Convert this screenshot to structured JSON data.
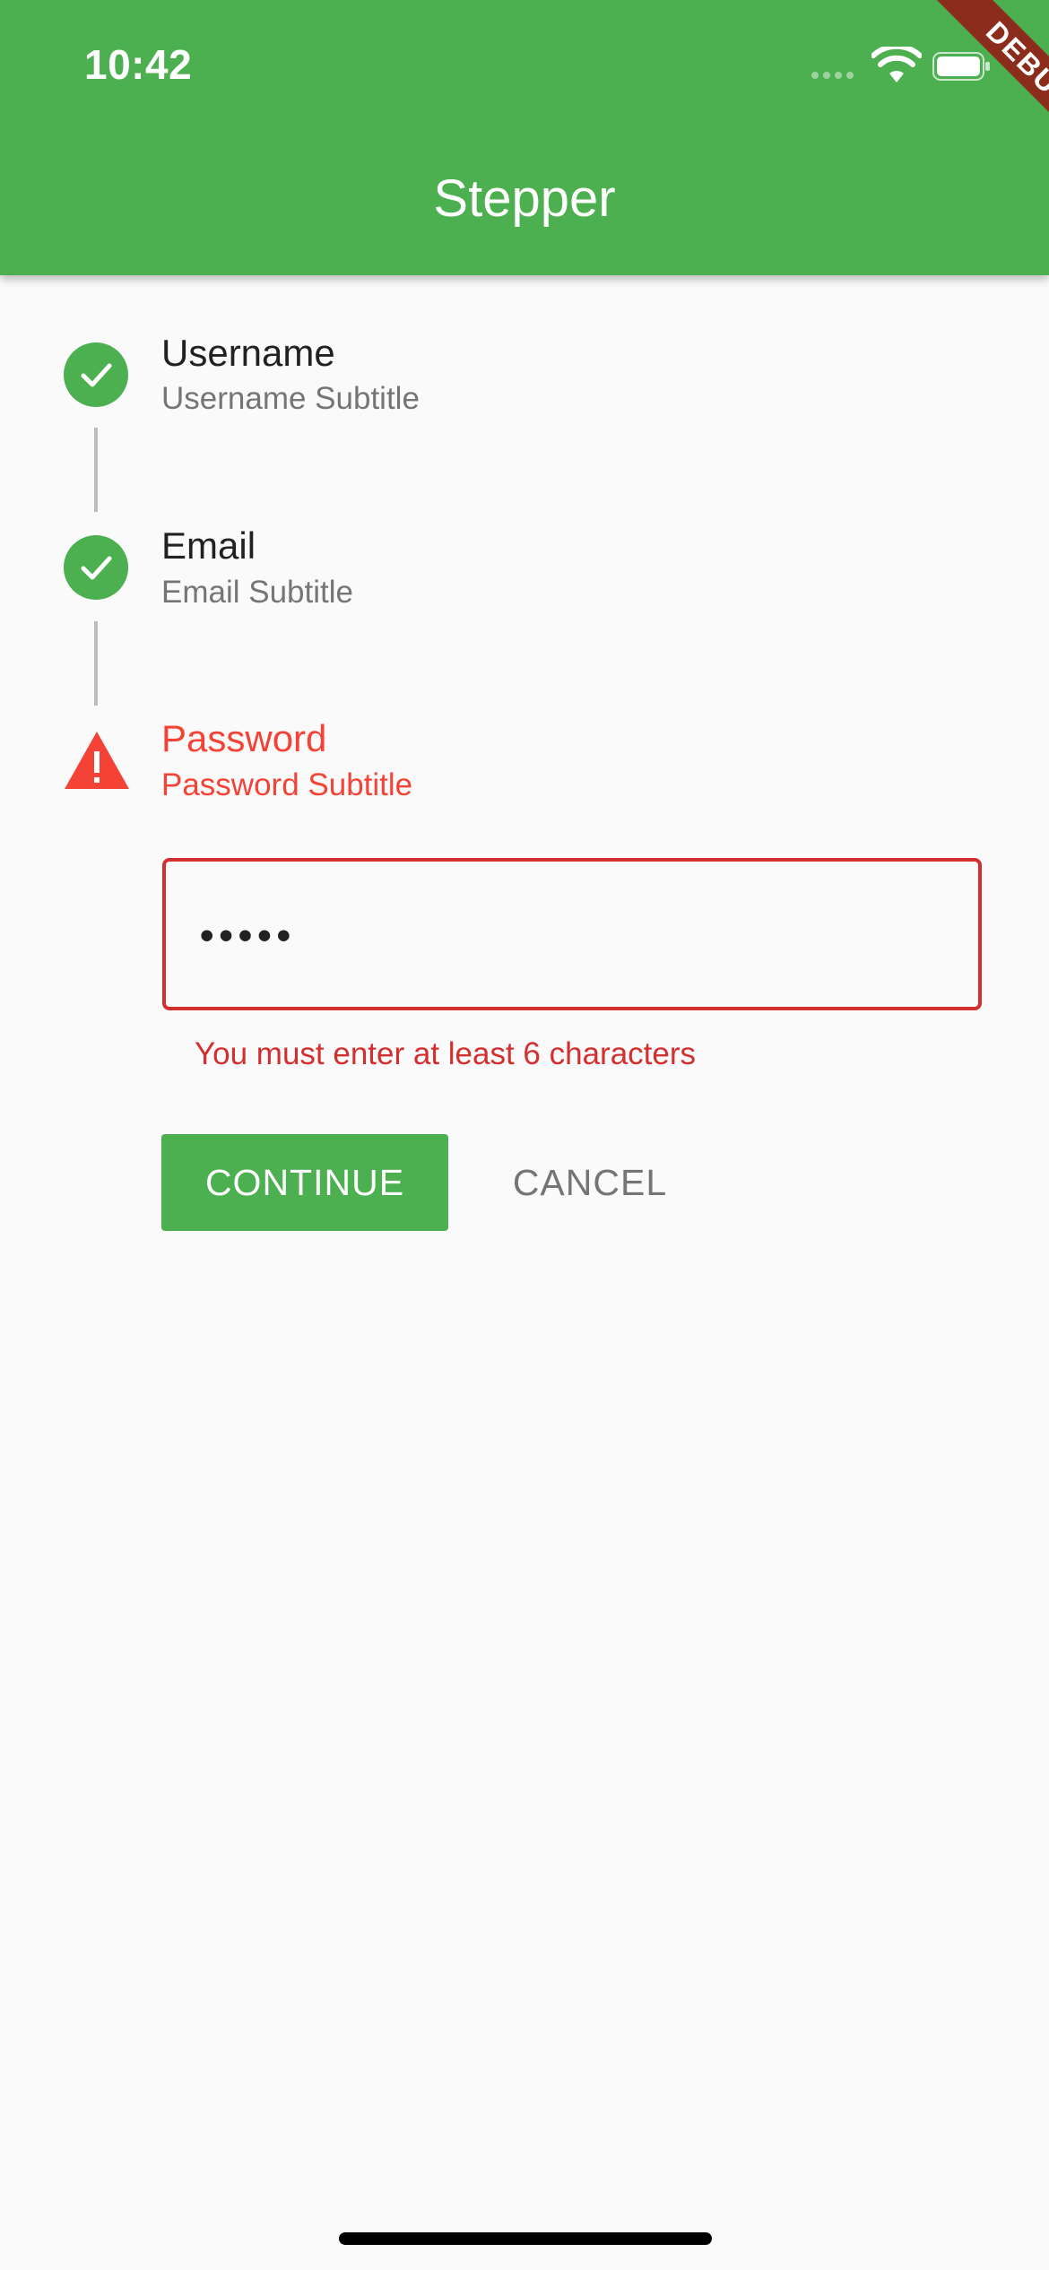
{
  "status_bar": {
    "time": "10:42",
    "icons": [
      "signal-dots-icon",
      "wifi-icon",
      "battery-icon"
    ]
  },
  "debug_banner": {
    "label": "DEBUG"
  },
  "app_bar": {
    "title": "Stepper"
  },
  "stepper": {
    "steps": [
      {
        "title": "Username",
        "subtitle": "Username Subtitle",
        "state": "complete",
        "icon": "check-icon"
      },
      {
        "title": "Email",
        "subtitle": "Email Subtitle",
        "state": "complete",
        "icon": "check-icon"
      },
      {
        "title": "Password",
        "subtitle": "Password Subtitle",
        "state": "error",
        "icon": "warning-icon"
      }
    ],
    "password_field": {
      "value": "•••••",
      "error": "You must enter at least 6 characters"
    },
    "controls": {
      "continue_label": "CONTINUE",
      "cancel_label": "CANCEL"
    }
  },
  "colors": {
    "primary": "#4caf50",
    "error": "#f44336",
    "error_dark": "#d32f2f",
    "background": "#fafafa",
    "debug_banner": "#8b2c1c"
  }
}
